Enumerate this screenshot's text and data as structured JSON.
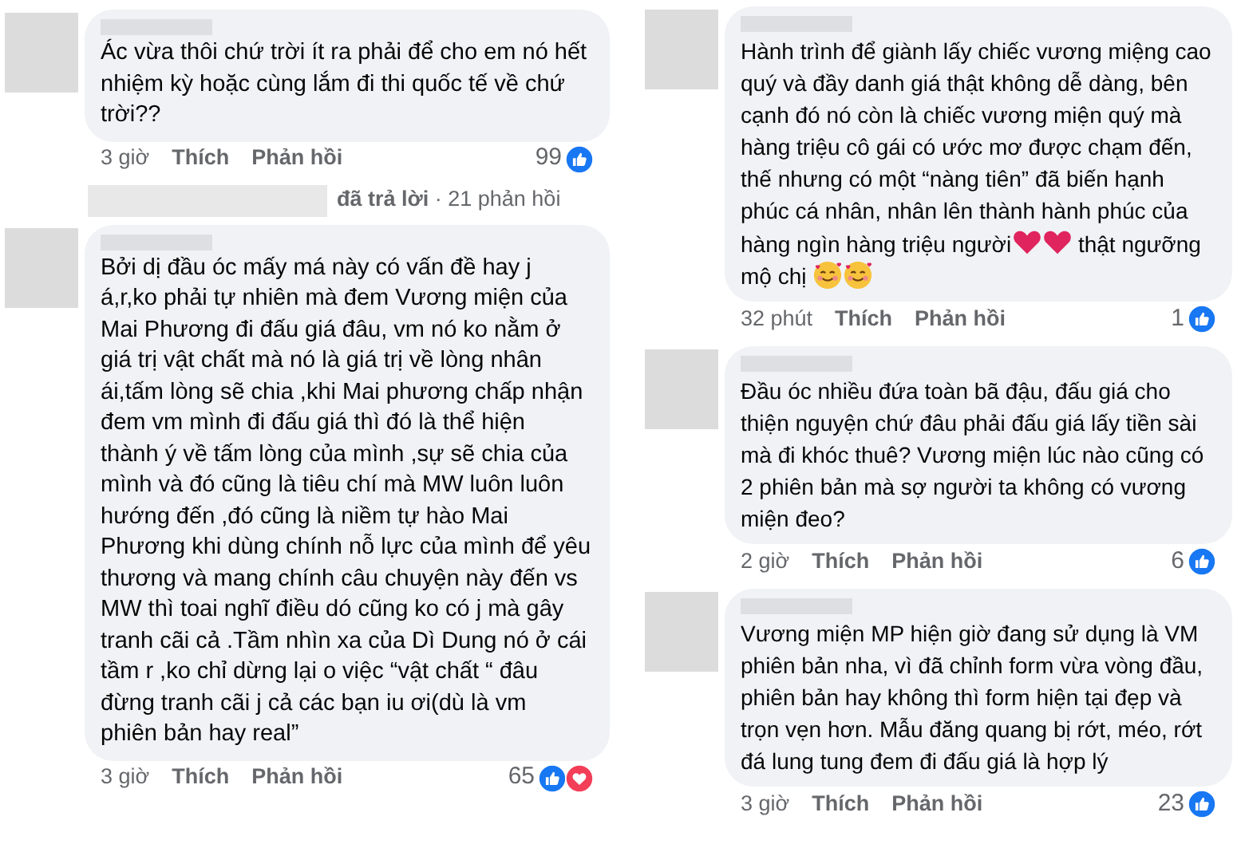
{
  "columns": [
    {
      "comments": [
        {
          "kind": "comment",
          "lines": [
            "Ác vừa thôi chứ trời ít ra phải để cho em nó hết",
            "nhiệm kỳ hoặc cùng lắm đi thi quốc tế về chứ",
            "trời??"
          ],
          "time": "3 giờ",
          "like": "Thích",
          "reply": "Phản hồi",
          "count": "99",
          "reactions": [
            {
              "kind": "like"
            }
          ]
        },
        {
          "kind": "replies",
          "text": "**đã trả lời** · 21 phản hồi"
        },
        {
          "kind": "comment",
          "lines": [
            "Bởi dị đầu óc mấy má này có vấn đề hay j",
            "á,r,ko phải tự nhiên mà đem Vương miện của",
            "Mai Phương đi đấu giá đâu, vm nó ko nằm ở",
            "giá trị vật chất mà nó là giá trị về lòng nhân",
            "ái,tấm lòng sẽ chia ,khi Mai phương chấp nhận",
            "đem vm mình đi đấu giá thì đó là thể hiện",
            "thành ý về tấm lòng của mình ,sự sẽ chia của",
            "mình và đó cũng là  tiêu chí mà MW luôn luôn",
            "hướng đến ,đó cũng là niềm tự hào Mai",
            "Phương khi dùng chính nỗ lực của mình để yêu",
            "thương và mang chính câu chuyện này đến vs",
            "MW thì toai nghĩ điều dó cũng ko có j mà gây",
            "tranh cãi cả .Tầm nhìn xa của Dì Dung nó ở cái",
            "tầm r ,ko chỉ dừng lại o việc “vật chất “ đâu",
            "đừng tranh cãi j cả các bạn iu ơi(dù là vm",
            "phiên bản hay real”"
          ],
          "time": "3 giờ",
          "like": "Thích",
          "reply": "Phản hồi",
          "count": "65",
          "reactions": [
            {
              "kind": "like"
            },
            {
              "kind": "love"
            }
          ]
        }
      ]
    },
    {
      "comments": [
        {
          "kind": "comment",
          "lines": [
            "Hành trình để giành lấy chiếc vương miệng cao",
            "quý và đầy danh giá thật không dễ dàng, bên",
            "cạnh đó nó còn là chiếc vương miện quý mà",
            "hàng triệu cô gái có ước mơ được chạm đến,",
            "thế nhưng có một “nàng tiên” đã biến hạnh",
            "phúc cá nhân, nhân lên thành hành phúc của",
            [
              {
                "kind": "text",
                "text": "hàng ngìn hàng triệu người"
              },
              {
                "kind": "heart"
              },
              {
                "kind": "heart"
              },
              {
                "kind": "text",
                "text": " thật ngưỡng"
              }
            ],
            [
              {
                "kind": "text",
                "text": "mộ chị "
              },
              {
                "kind": "smile-hearts"
              },
              {
                "kind": "smile-hearts"
              }
            ]
          ],
          "time": "32 phút",
          "like": "Thích",
          "reply": "Phản hồi",
          "count": "1",
          "reactions": [
            {
              "kind": "like"
            }
          ]
        },
        {
          "kind": "comment",
          "lines": [
            "Đầu óc nhiều đứa toàn bã đậu, đấu giá cho",
            "thiện nguyện chứ đâu phải đấu giá lấy tiền sài",
            "mà đi khóc thuê? Vương miện lúc nào cũng có",
            "2 phiên bản mà sợ người ta không có vương",
            "miện đeo?"
          ],
          "time": "2 giờ",
          "like": "Thích",
          "reply": "Phản hồi",
          "count": "6",
          "reactions": [
            {
              "kind": "like"
            }
          ]
        },
        {
          "kind": "comment",
          "lines": [
            "Vương miện MP hiện giờ đang sử dụng là VM",
            "phiên bản nha, vì đã chỉnh form vừa vòng đầu,",
            "phiên bản hay không thì form hiện tại đẹp và",
            "trọn vẹn hơn. Mẫu đăng quang bị rớt, méo, rớt",
            "đá lung tung  đem đi đấu giá là hợp lý"
          ],
          "time": "3 giờ",
          "like": "Thích",
          "reply": "Phản hồi",
          "count": "23",
          "reactions": [
            {
              "kind": "like"
            }
          ]
        }
      ]
    }
  ]
}
